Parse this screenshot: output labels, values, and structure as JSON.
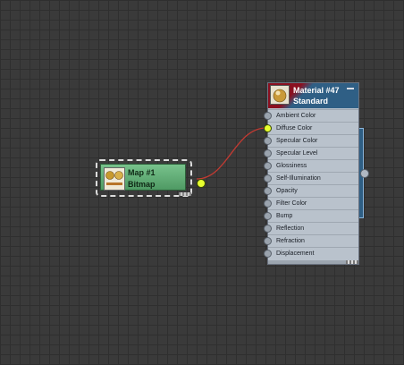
{
  "map_node": {
    "title": "Map #1",
    "subtitle": "Bitmap",
    "thumbnail_icon": "bitmap-thumbnail-icon",
    "color": "#5fac72"
  },
  "material_node": {
    "title": "Material #47",
    "subtitle": "Standard",
    "thumbnail_icon": "material-sphere-thumbnail-icon",
    "header_accent": "#8a1020",
    "header_color": "#2f5f85",
    "slots": [
      {
        "label": "Ambient Color",
        "connected": false
      },
      {
        "label": "Diffuse Color",
        "connected": true
      },
      {
        "label": "Specular Color",
        "connected": false
      },
      {
        "label": "Specular Level",
        "connected": false
      },
      {
        "label": "Glossiness",
        "connected": false
      },
      {
        "label": "Self-Illumination",
        "connected": false
      },
      {
        "label": "Opacity",
        "connected": false
      },
      {
        "label": "Filter Color",
        "connected": false
      },
      {
        "label": "Bump",
        "connected": false
      },
      {
        "label": "Reflection",
        "connected": false
      },
      {
        "label": "Refraction",
        "connected": false
      },
      {
        "label": "Displacement",
        "connected": false
      }
    ]
  },
  "wire_color": "#c23a32",
  "active_port_color": "#e8ff30"
}
